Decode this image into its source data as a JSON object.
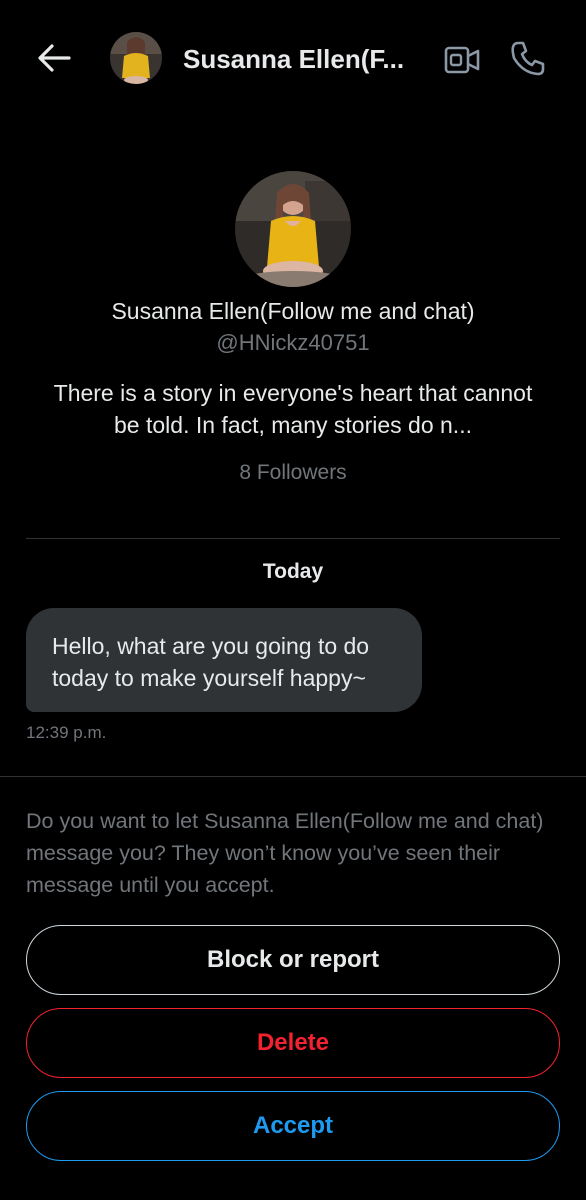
{
  "header": {
    "title": "Susanna Ellen(F...",
    "back_icon": "arrow-left-icon",
    "video_icon": "video-call-icon",
    "phone_icon": "phone-icon"
  },
  "profile": {
    "name": "Susanna Ellen(Follow me and chat)",
    "handle": "@HNickz40751",
    "bio": "There is a story in everyone's heart that cannot be told. In fact, many stories do n...",
    "followers": "8 Followers"
  },
  "conversation": {
    "day_label": "Today",
    "messages": [
      {
        "text": "Hello, what are you going to do today to make yourself happy~",
        "time": "12:39 p.m."
      }
    ]
  },
  "request": {
    "prompt": "Do you want to let Susanna Ellen(Follow me and chat) message you? They won’t know you’ve seen their message until you accept.",
    "block_label": "Block or report",
    "delete_label": "Delete",
    "accept_label": "Accept"
  },
  "colors": {
    "background": "#000000",
    "text": "#e7e9ea",
    "muted": "#71767b",
    "bubble": "#2f3336",
    "danger": "#f4212e",
    "accent": "#1d9bf0"
  }
}
